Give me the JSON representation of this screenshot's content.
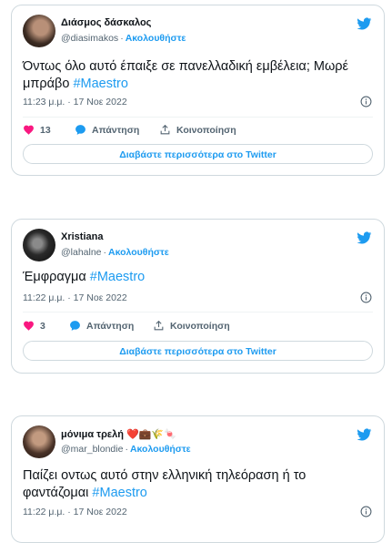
{
  "colors": {
    "accent": "#1d9bf0",
    "like": "#f91880",
    "text": "#0f1419",
    "muted": "#536471",
    "border": "#cfd9de"
  },
  "tweets": [
    {
      "name": "Διάσμος δάσκαλος",
      "handle": "@diasimakos",
      "follow": "Ακολουθήστε",
      "text_plain": "Όντως όλο αυτό έπαιξε σε πανελλαδική εμβέλεια; Μωρέ μπράβο ",
      "hashtag": "#Maestro",
      "time": "11:23 μ.μ. · 17 Νοε 2022",
      "likes": "13",
      "reply": "Απάντηση",
      "share": "Κοινοποίηση",
      "read_more": "Διαβάστε περισσότερα στο Twitter"
    },
    {
      "name": "Xristiana",
      "handle": "@lahalne",
      "follow": "Ακολουθήστε",
      "text_plain": "Έμφραγμα ",
      "hashtag": "#Maestro",
      "time": "11:22 μ.μ. · 17 Νοε 2022",
      "likes": "3",
      "reply": "Απάντηση",
      "share": "Κοινοποίηση",
      "read_more": "Διαβάστε περισσότερα στο Twitter"
    },
    {
      "name": "μόνιμα τρελή ❤️💼🌾🍬",
      "handle": "@mar_blondie",
      "follow": "Ακολουθήστε",
      "text_plain": "Παίζει οντως αυτό στην ελληνική τηλεόραση ή το φαντάζομαι ",
      "hashtag": "#Maestro",
      "time": "11:22 μ.μ. · 17 Νοε 2022"
    }
  ],
  "icons": {
    "bird": "twitter-bird-icon",
    "info": "info-icon",
    "heart": "heart-icon",
    "reply": "reply-bubble-icon",
    "share": "share-icon"
  }
}
